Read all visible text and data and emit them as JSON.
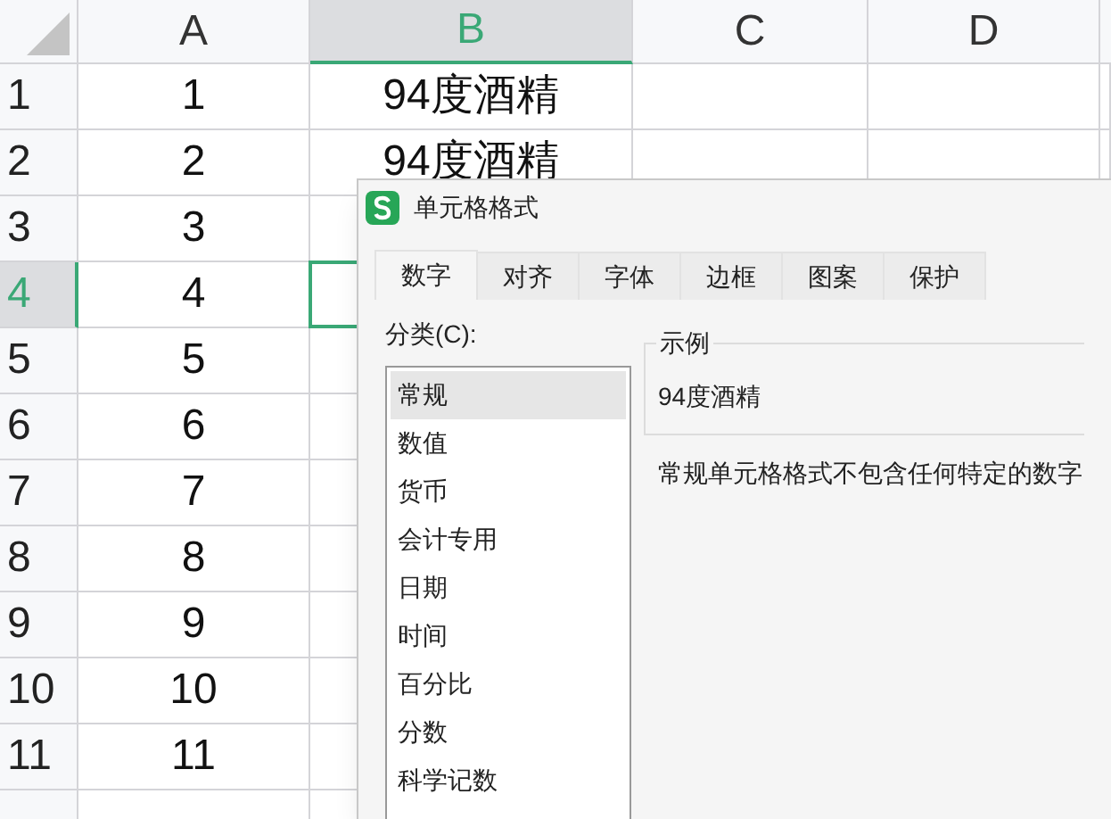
{
  "columns": [
    {
      "label": "A",
      "selected": false
    },
    {
      "label": "B",
      "selected": true
    },
    {
      "label": "C",
      "selected": false
    },
    {
      "label": "D",
      "selected": false
    }
  ],
  "rows": [
    {
      "label": "1",
      "selected": false,
      "values": [
        "1",
        "94度酒精"
      ]
    },
    {
      "label": "2",
      "selected": false,
      "values": [
        "2",
        "94度酒精"
      ]
    },
    {
      "label": "3",
      "selected": false,
      "values": [
        "3"
      ]
    },
    {
      "label": "4",
      "selected": true,
      "values": [
        "4"
      ]
    },
    {
      "label": "5",
      "selected": false,
      "values": [
        "5"
      ]
    },
    {
      "label": "6",
      "selected": false,
      "values": [
        "6"
      ]
    },
    {
      "label": "7",
      "selected": false,
      "values": [
        "7"
      ]
    },
    {
      "label": "8",
      "selected": false,
      "values": [
        "8"
      ]
    },
    {
      "label": "9",
      "selected": false,
      "values": [
        "9"
      ]
    },
    {
      "label": "10",
      "selected": false,
      "values": [
        "10"
      ]
    },
    {
      "label": "11",
      "selected": false,
      "values": [
        "11"
      ]
    }
  ],
  "dialog": {
    "title": "单元格格式",
    "tabs": [
      {
        "label": "数字",
        "selected": true
      },
      {
        "label": "对齐",
        "selected": false
      },
      {
        "label": "字体",
        "selected": false
      },
      {
        "label": "边框",
        "selected": false
      },
      {
        "label": "图案",
        "selected": false
      },
      {
        "label": "保护",
        "selected": false
      }
    ],
    "category_label": "分类(C):",
    "categories": [
      {
        "label": "常规",
        "selected": true
      },
      {
        "label": "数值",
        "selected": false
      },
      {
        "label": "货币",
        "selected": false
      },
      {
        "label": "会计专用",
        "selected": false
      },
      {
        "label": "日期",
        "selected": false
      },
      {
        "label": "时间",
        "selected": false
      },
      {
        "label": "百分比",
        "selected": false
      },
      {
        "label": "分数",
        "selected": false
      },
      {
        "label": "科学记数",
        "selected": false
      }
    ],
    "sample": {
      "legend": "示例",
      "value": "94度酒精"
    },
    "description": "常规单元格格式不包含任何特定的数字"
  }
}
